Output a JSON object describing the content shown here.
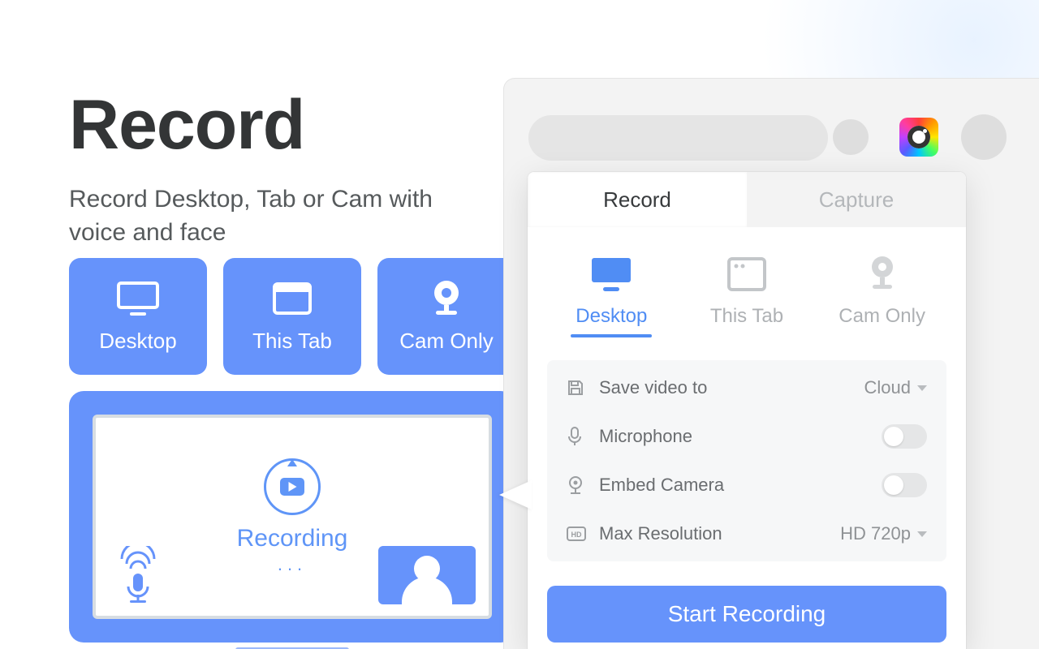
{
  "hero": {
    "title": "Record",
    "subtitle": "Record Desktop, Tab or Cam with voice and face"
  },
  "mode_buttons": {
    "desktop": "Desktop",
    "this_tab": "This Tab",
    "cam_only": "Cam Only"
  },
  "preview": {
    "status": "Recording",
    "dots": "..."
  },
  "popup": {
    "tabs": {
      "record": "Record",
      "capture": "Capture"
    },
    "sources": {
      "desktop": "Desktop",
      "this_tab": "This Tab",
      "cam_only": "Cam Only"
    },
    "settings": {
      "save_video_to": {
        "label": "Save video to",
        "value": "Cloud"
      },
      "microphone": {
        "label": "Microphone",
        "enabled": false
      },
      "embed_camera": {
        "label": "Embed Camera",
        "enabled": false
      },
      "max_resolution": {
        "label": "Max Resolution",
        "value": "HD 720p"
      }
    },
    "start_button": "Start Recording"
  }
}
